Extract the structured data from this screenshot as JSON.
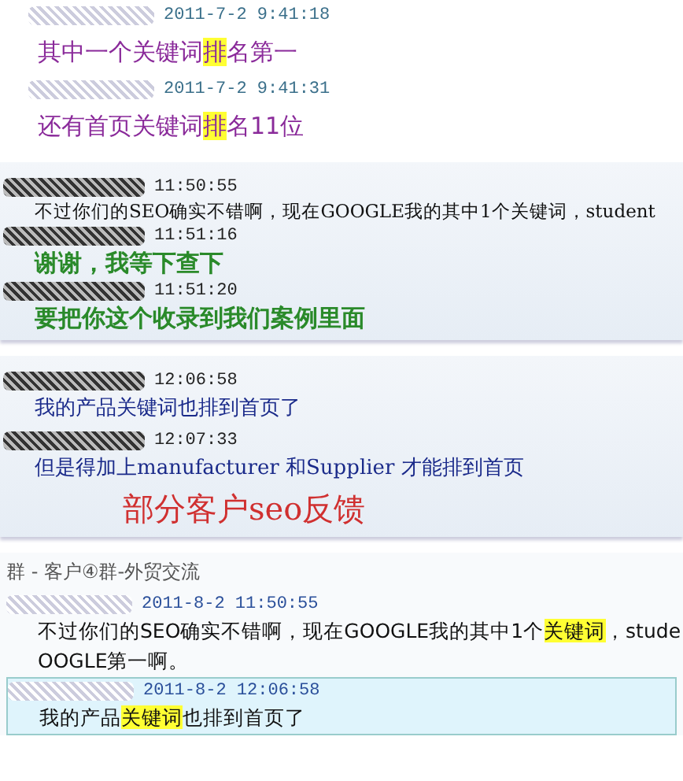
{
  "panels": [
    {
      "kind": "plain",
      "messages": [
        {
          "time": "2011-7-2 9:41:18",
          "kind": "purple",
          "lines": [
            [
              {
                "text": "其中一个关键词",
                "highlighted": false
              },
              {
                "text": "排",
                "highlighted": true
              },
              {
                "text": "名第一",
                "highlighted": false
              }
            ]
          ],
          "selected": false
        },
        {
          "time": "2011-7-2 9:41:31",
          "kind": "purple",
          "lines": [
            [
              {
                "text": "还有首页关键词",
                "highlighted": false
              },
              {
                "text": "排",
                "highlighted": true
              },
              {
                "text": "名11位",
                "highlighted": false
              }
            ]
          ],
          "selected": false
        }
      ]
    },
    {
      "kind": "tinted",
      "messages": [
        {
          "time": "11:50:55",
          "kind": "serif",
          "lines": [
            [
              {
                "text": "不过你们的SEO确实不错啊，现在GOOGLE我的其中1个关键词，student",
                "highlighted": false
              }
            ]
          ],
          "selected": false
        },
        {
          "time": "11:51:16",
          "kind": "green",
          "lines": [
            [
              {
                "text": "谢谢，我等下查下",
                "highlighted": false
              }
            ]
          ],
          "selected": false
        },
        {
          "time": "11:51:20",
          "kind": "green",
          "lines": [
            [
              {
                "text": "要把你这个收录到我们案例里面",
                "highlighted": false
              }
            ]
          ],
          "selected": false
        }
      ]
    },
    {
      "kind": "tinted",
      "messages": [
        {
          "time": "12:06:58",
          "kind": "blue-serif",
          "lines": [
            [
              {
                "text": "我的产品关键词也排到首页了",
                "highlighted": false
              }
            ]
          ],
          "selected": false
        },
        {
          "time": "12:07:33",
          "kind": "blue-serif",
          "lines": [
            [
              {
                "text": "但是得加上manufacturer 和Supplier 才能排到首页",
                "highlighted": false
              }
            ]
          ],
          "selected": false
        }
      ],
      "caption": "部分客户seo反馈"
    },
    {
      "kind": "group",
      "title": "群 - 客户④群-外贸交流",
      "messages": [
        {
          "time": "2011-8-2 11:50:55",
          "kind": "sans",
          "lines": [
            [
              {
                "text": "不过你们的SEO确实不错啊，现在GOOGLE我的其中1个",
                "highlighted": false
              },
              {
                "text": "关键词",
                "highlighted": true
              },
              {
                "text": "，stude",
                "highlighted": false
              }
            ],
            [
              {
                "text": "OOGLE第一啊。",
                "highlighted": false
              }
            ]
          ],
          "selected": false
        },
        {
          "time": "2011-8-2 12:06:58",
          "kind": "sans",
          "lines": [
            [
              {
                "text": "我的产品",
                "highlighted": false
              },
              {
                "text": "关键词",
                "highlighted": true
              },
              {
                "text": "也排到首页了",
                "highlighted": false
              }
            ]
          ],
          "selected": true
        }
      ]
    }
  ]
}
